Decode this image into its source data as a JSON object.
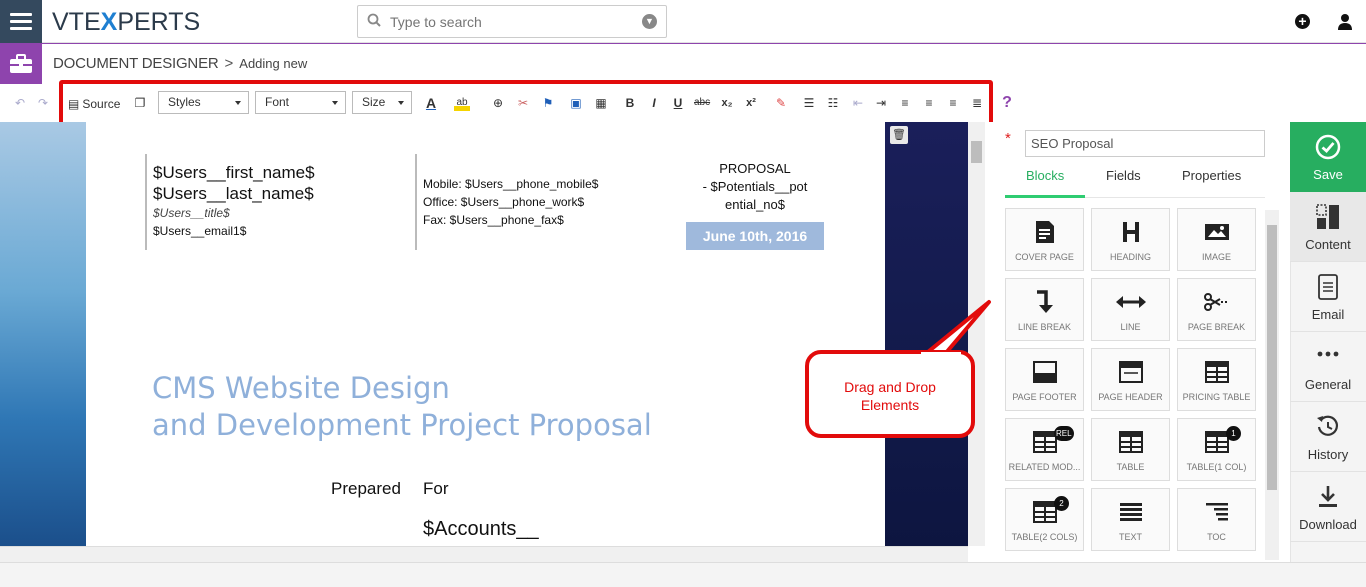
{
  "header": {
    "logo_prefix": "VTE",
    "logo_x": "X",
    "logo_suffix": "PERTS",
    "search_placeholder": "Type to search"
  },
  "breadcrumb": {
    "title": "DOCUMENT DESIGNER",
    "separator": ">",
    "sub": "Adding new"
  },
  "toolbar": {
    "source_label": "Source",
    "styles_label": "Styles",
    "font_label": "Font",
    "size_label": "Size"
  },
  "document": {
    "first_name": "$Users__first_name$",
    "last_name": "$Users__last_name$",
    "title_var": "$Users__title$",
    "email_var": "$Users__email1$",
    "mobile": "Mobile: $Users__phone_mobile$",
    "office": "Office: $Users__phone_work$",
    "fax": "Fax: $Users__phone_fax$",
    "proposal_label": "PROPOSAL",
    "proposal_no_1": "- $Potentials__pot",
    "proposal_no_2": "ential_no$",
    "date": "June 10th, 2016",
    "heading_1": "CMS Website Design",
    "heading_2": "and Development Project Proposal",
    "prepared": "Prepared",
    "for": "For",
    "accounts": "$Accounts__"
  },
  "panel": {
    "doc_title_value": "SEO Proposal",
    "tabs": [
      "Blocks",
      "Fields",
      "Properties"
    ],
    "blocks": [
      {
        "label": "COVER PAGE",
        "icon": "cover-page-icon"
      },
      {
        "label": "HEADING",
        "icon": "heading-icon"
      },
      {
        "label": "IMAGE",
        "icon": "image-icon"
      },
      {
        "label": "LINE BREAK",
        "icon": "line-break-icon"
      },
      {
        "label": "LINE",
        "icon": "line-icon"
      },
      {
        "label": "PAGE BREAK",
        "icon": "page-break-icon"
      },
      {
        "label": "PAGE FOOTER",
        "icon": "page-footer-icon"
      },
      {
        "label": "PAGE HEADER",
        "icon": "page-header-icon"
      },
      {
        "label": "PRICING TABLE",
        "icon": "pricing-table-icon"
      },
      {
        "label": "RELATED MOD...",
        "icon": "related-modules-icon",
        "badge": "REL"
      },
      {
        "label": "TABLE",
        "icon": "table-icon"
      },
      {
        "label": "TABLE(1 COL)",
        "icon": "table-1-col-icon",
        "badge": "1"
      },
      {
        "label": "TABLE(2 COLS)",
        "icon": "table-2-cols-icon",
        "badge": "2"
      },
      {
        "label": "TEXT",
        "icon": "text-icon"
      },
      {
        "label": "TOC",
        "icon": "toc-icon"
      }
    ]
  },
  "sidenav": {
    "save": "Save",
    "content": "Content",
    "email": "Email",
    "general": "General",
    "history": "History",
    "download": "Download"
  },
  "callout": {
    "line1": "Drag and Drop",
    "line2": "Elements"
  },
  "colors": {
    "purple": "#8e44ad",
    "green": "#2ecc71",
    "red_annotation": "#e20b0b",
    "heading_blue": "#8fb0da",
    "dark_nav": "#34495e"
  }
}
